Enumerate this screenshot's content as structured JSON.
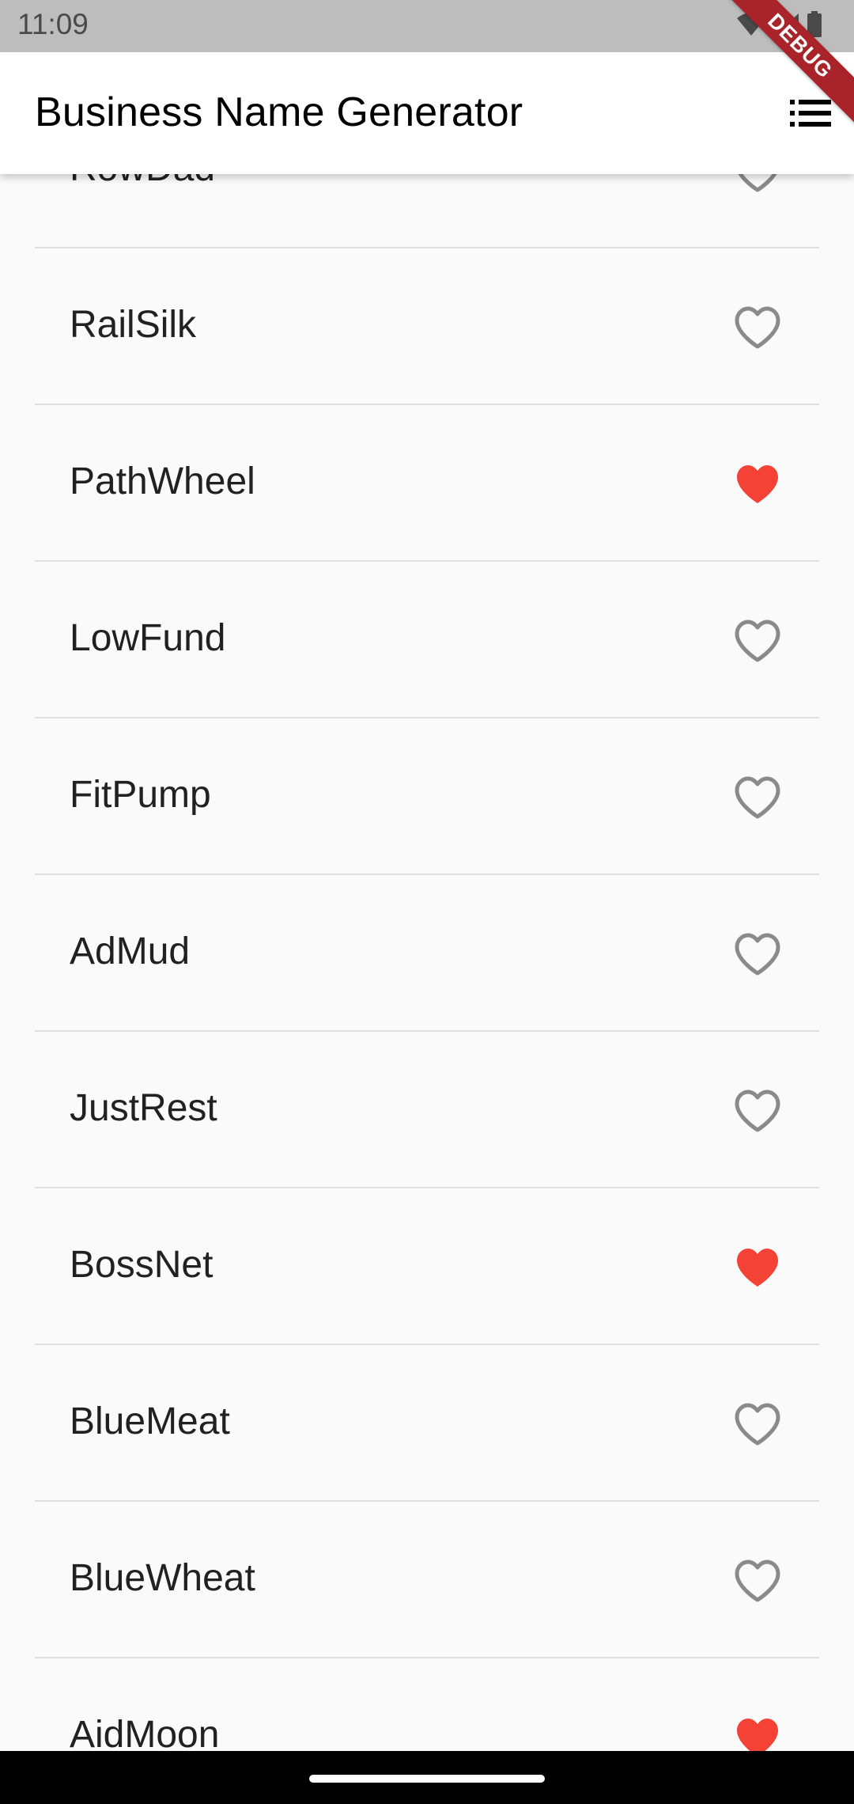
{
  "status_bar": {
    "time": "11:09"
  },
  "debug_banner": {
    "label": "DEBUG"
  },
  "app_bar": {
    "title": "Business Name Generator",
    "action_icon": "list-icon"
  },
  "colors": {
    "favorite": "#f44336",
    "not_favorite": "#8a8a8a",
    "text": "#212121"
  },
  "list": {
    "items": [
      {
        "label": "RowDad",
        "favorited": false
      },
      {
        "label": "RailSilk",
        "favorited": false
      },
      {
        "label": "PathWheel",
        "favorited": true
      },
      {
        "label": "LowFund",
        "favorited": false
      },
      {
        "label": "FitPump",
        "favorited": false
      },
      {
        "label": "AdMud",
        "favorited": false
      },
      {
        "label": "JustRest",
        "favorited": false
      },
      {
        "label": "BossNet",
        "favorited": true
      },
      {
        "label": "BlueMeat",
        "favorited": false
      },
      {
        "label": "BlueWheat",
        "favorited": false
      },
      {
        "label": "AidMoon",
        "favorited": true
      }
    ]
  }
}
